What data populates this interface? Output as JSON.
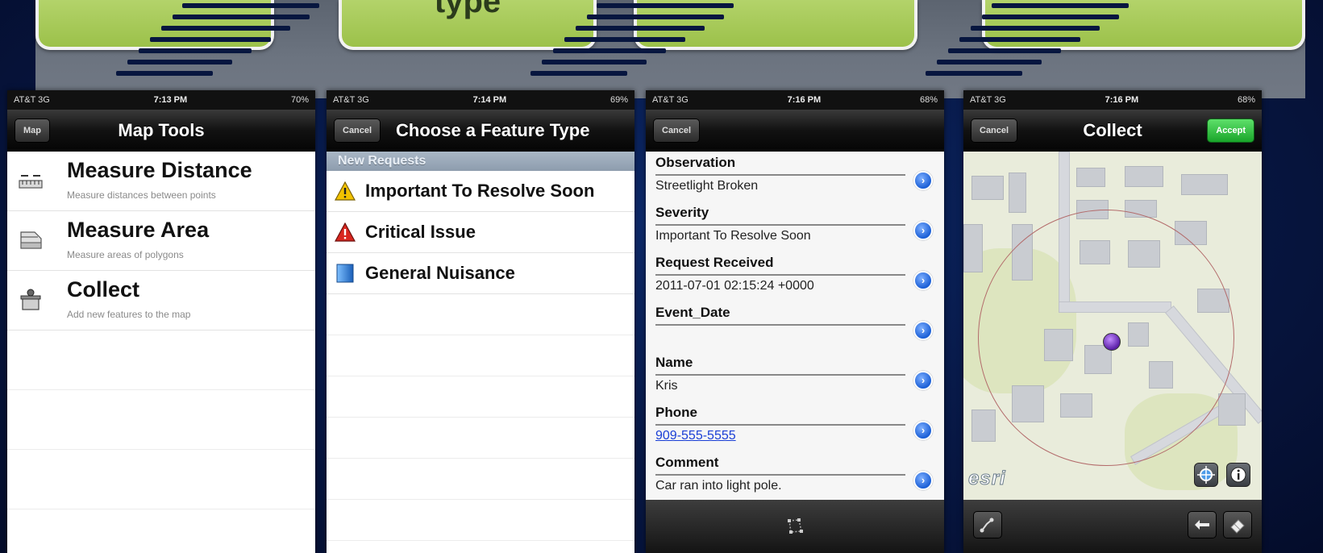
{
  "banner": {
    "box2_text": "type"
  },
  "phones": [
    {
      "status": {
        "carrier": "AT&T 3G",
        "time": "7:13 PM",
        "battery": "70%"
      },
      "nav": {
        "title": "Map Tools",
        "left_button": "Map"
      },
      "tools": [
        {
          "title": "Measure Distance",
          "subtitle": "Measure distances between points",
          "icon": "ruler-icon"
        },
        {
          "title": "Measure Area",
          "subtitle": "Measure areas of polygons",
          "icon": "area-icon"
        },
        {
          "title": "Collect",
          "subtitle": "Add new features to the map",
          "icon": "collect-icon"
        }
      ]
    },
    {
      "status": {
        "carrier": "AT&T 3G",
        "time": "7:14 PM",
        "battery": "69%"
      },
      "nav": {
        "title": "Choose a Feature Type",
        "left_button": "Cancel"
      },
      "section_header": "New Requests",
      "feature_types": [
        {
          "label": "Important To Resolve Soon",
          "icon": "warning-yellow-icon",
          "color": "#f2c200"
        },
        {
          "label": "Critical Issue",
          "icon": "warning-red-icon",
          "color": "#d8261f"
        },
        {
          "label": "General Nuisance",
          "icon": "blue-square-icon",
          "color": "#2a7fd6"
        }
      ]
    },
    {
      "status": {
        "carrier": "AT&T 3G",
        "time": "7:16 PM",
        "battery": "68%"
      },
      "nav": {
        "title": "",
        "left_button": "Cancel"
      },
      "attributes": [
        {
          "name": "Observation",
          "value": "Streetlight Broken"
        },
        {
          "name": "Severity",
          "value": "Important To Resolve Soon"
        },
        {
          "name": "Request Received",
          "value": "2011-07-01 02:15:24 +0000"
        },
        {
          "name": "Event_Date",
          "value": ""
        },
        {
          "name": "Name",
          "value": "Kris"
        },
        {
          "name": "Phone",
          "value": "909-555-5555"
        },
        {
          "name": "Comment",
          "value": "Car ran into light pole."
        }
      ]
    },
    {
      "status": {
        "carrier": "AT&T 3G",
        "time": "7:16 PM",
        "battery": "68%"
      },
      "nav": {
        "title": "Collect",
        "left_button": "Cancel",
        "right_button": "Accept"
      },
      "map": {
        "logo": "esri"
      }
    }
  ]
}
